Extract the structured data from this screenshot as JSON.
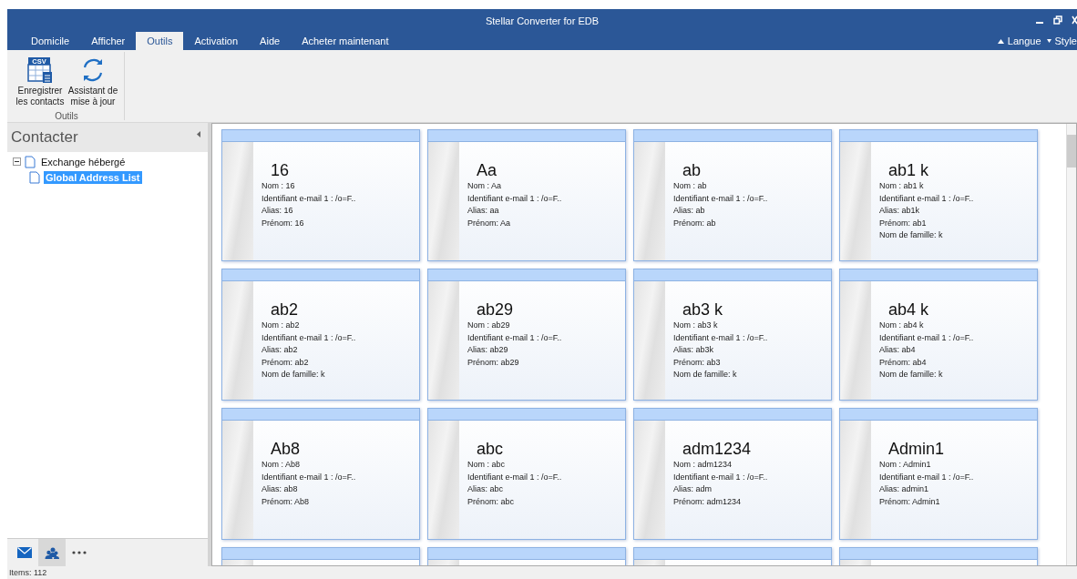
{
  "window": {
    "title": "Stellar Converter for EDB"
  },
  "tabs": [
    {
      "label": "Domicile",
      "selected": false
    },
    {
      "label": "Afficher",
      "selected": false
    },
    {
      "label": "Outils",
      "selected": true
    },
    {
      "label": "Activation",
      "selected": false
    },
    {
      "label": "Aide",
      "selected": false
    },
    {
      "label": "Acheter maintenant",
      "selected": false
    }
  ],
  "ribbon_right": [
    {
      "kind": "up",
      "label": "Langue"
    },
    {
      "kind": "down",
      "label": "Style"
    }
  ],
  "ribbon": {
    "group": "Outils",
    "buttons": [
      {
        "kind": "csv",
        "icon_text": "CSV",
        "label": "Enregistrer les contacts"
      },
      {
        "kind": "refresh",
        "label": "Assistant de mise à jour"
      }
    ]
  },
  "sidebar": {
    "title": "Contacter",
    "tree": [
      {
        "label": "Exchange hébergé",
        "expanded": true,
        "selected": false,
        "children": [
          {
            "label": "Global Address List",
            "selected": true
          }
        ]
      }
    ],
    "nav": [
      {
        "kind": "mail",
        "selected": false
      },
      {
        "kind": "contacts",
        "selected": true
      },
      {
        "kind": "more",
        "selected": false
      }
    ]
  },
  "cards": [
    {
      "name": "16",
      "lines": [
        "Nom : 16",
        "Identifiant e-mail 1 : /o=F..",
        "Alias: 16",
        "Prénom: 16"
      ]
    },
    {
      "name": "Aa",
      "lines": [
        "Nom : Aa",
        "Identifiant e-mail 1 : /o=F..",
        "Alias: aa",
        "Prénom: Aa"
      ]
    },
    {
      "name": "ab",
      "lines": [
        "Nom : ab",
        "Identifiant e-mail 1 : /o=F..",
        "Alias: ab",
        "Prénom: ab"
      ]
    },
    {
      "name": "ab1 k",
      "lines": [
        "Nom : ab1 k",
        "Identifiant e-mail 1 : /o=F..",
        "Alias: ab1k",
        "Prénom: ab1",
        "Nom de famille: k"
      ]
    },
    {
      "name": "ab2",
      "lines": [
        "Nom : ab2",
        "Identifiant e-mail 1 : /o=F..",
        "Alias: ab2",
        "Prénom: ab2",
        "Nom de famille: k"
      ]
    },
    {
      "name": "ab29",
      "lines": [
        "Nom : ab29",
        "Identifiant e-mail 1 : /o=F..",
        "Alias: ab29",
        "Prénom: ab29"
      ]
    },
    {
      "name": "ab3 k",
      "lines": [
        "Nom : ab3 k",
        "Identifiant e-mail 1 : /o=F..",
        "Alias: ab3k",
        "Prénom: ab3",
        "Nom de famille: k"
      ]
    },
    {
      "name": "ab4 k",
      "lines": [
        "Nom : ab4 k",
        "Identifiant e-mail 1 : /o=F..",
        "Alias: ab4",
        "Prénom: ab4",
        "Nom de famille: k"
      ]
    },
    {
      "name": "Ab8",
      "lines": [
        "Nom : Ab8",
        "Identifiant e-mail 1 : /o=F..",
        "Alias: ab8",
        "Prénom: Ab8"
      ]
    },
    {
      "name": "abc",
      "lines": [
        "Nom : abc",
        "Identifiant e-mail 1 : /o=F..",
        "Alias: abc",
        "Prénom: abc"
      ]
    },
    {
      "name": "adm1234",
      "lines": [
        "Nom : adm1234",
        "Identifiant e-mail 1 : /o=F..",
        "Alias: adm",
        "Prénom: adm1234"
      ]
    },
    {
      "name": "Admin1",
      "lines": [
        "Nom : Admin1",
        "Identifiant e-mail 1 : /o=F..",
        "Alias: admin1",
        "Prénom: Admin1"
      ]
    }
  ],
  "status_bar": "Items: 112"
}
